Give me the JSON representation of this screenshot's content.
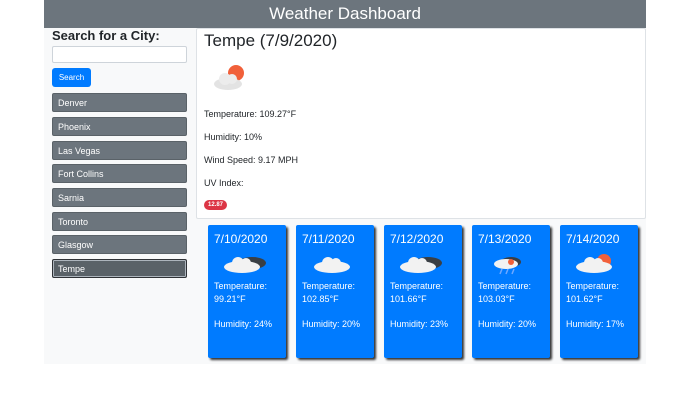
{
  "header": {
    "title": "Weather Dashboard"
  },
  "sidebar": {
    "search_label": "Search for a City:",
    "search_value": "",
    "search_button": "Search",
    "cities": [
      "Denver",
      "Phoenix",
      "Las Vegas",
      "Fort Collins",
      "Sarnia",
      "Toronto",
      "Glasgow",
      "Tempe"
    ],
    "active_city": "Tempe"
  },
  "current": {
    "title": "Tempe (7/9/2020)",
    "icon": "few-clouds-day-icon",
    "temperature": "Temperature: 109.27°F",
    "humidity": "Humidity: 10%",
    "wind": "Wind Speed: 9.17 MPH",
    "uv_label": "UV Index:",
    "uv_value": "12.87",
    "uv_color": "#dc3545"
  },
  "forecast": [
    {
      "date": "7/10/2020",
      "icon": "broken-clouds-icon",
      "temp": "Temperature: 99.21°F",
      "humidity": "Humidity: 24%"
    },
    {
      "date": "7/11/2020",
      "icon": "scattered-clouds-icon",
      "temp": "Temperature: 102.85°F",
      "humidity": "Humidity: 20%"
    },
    {
      "date": "7/12/2020",
      "icon": "broken-clouds-icon",
      "temp": "Temperature: 101.66°F",
      "humidity": "Humidity: 23%"
    },
    {
      "date": "7/13/2020",
      "icon": "rain-icon",
      "temp": "Temperature: 103.03°F",
      "humidity": "Humidity: 20%"
    },
    {
      "date": "7/14/2020",
      "icon": "few-clouds-day-icon",
      "temp": "Temperature: 101.62°F",
      "humidity": "Humidity: 17%"
    }
  ],
  "colors": {
    "header": "#6c757d",
    "primary": "#007bff",
    "city_button": "#6c757d",
    "badge": "#dc3545"
  }
}
